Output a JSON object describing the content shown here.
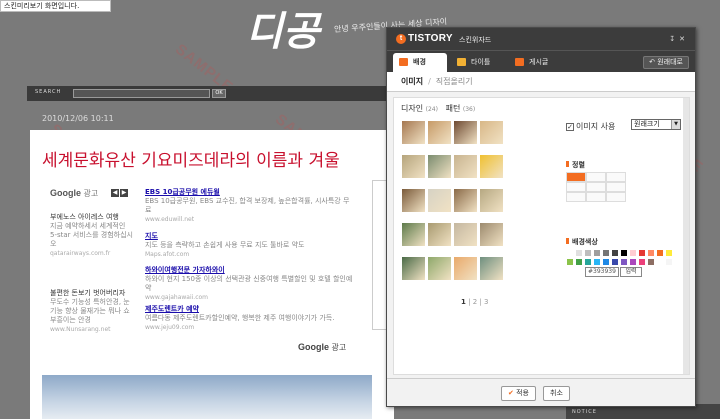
{
  "preview_notice": "스킨미리보기 화면입니다.",
  "watermark": "SAMPLE",
  "blog": {
    "logo": "디공",
    "tagline": "안녕 우주인들이 사는 세상 디자이",
    "search_label": "SEARCH",
    "search_button": "OK",
    "post_date": "2010/12/06 10:11",
    "post_title": "세계문화유산 기요미즈데라의 이름과 겨울",
    "google_label": "Google",
    "ad_word": "광고",
    "left_ads": [
      {
        "title": "부에노스 아이레스 여행",
        "desc": "지금 예약하세서 세계적인 5-star 서비스를 경험하십시오",
        "url": "qatarairways.com.fr"
      },
      {
        "title": "불편한 돈보기 벗어버리자",
        "desc": "무도수 기능성 특허안경, 눈기능 향상 물재가는 뭐나 쇼 부흥이는 안경",
        "url": "www.Nunsarang.net"
      }
    ],
    "right_ads": [
      {
        "title": "EBS 10급공무원 에듀윌",
        "desc": "EBS 10급공무원, EBS 교수진, 합격 보장제, 높은합격률, 시사특강 무료",
        "url": "www.eduwill.net"
      },
      {
        "title": "지도",
        "desc": "지도 등을 측략하고 손쉽게 사용 무료 지도 툴바로 약도",
        "url": "Maps.afot.com"
      },
      {
        "title": "하와이여행전문 가자하와이",
        "desc": "하와이 현지 150종 이상의 선택관광 신중여행 특별할인 및 호텔 할인예약",
        "url": "www.gajahawaii.com"
      },
      {
        "title": "제주도렌트카 예약",
        "desc": "여름다동 제주도렌트카할인예약, 행복한 제주 여행이야기가 가득.",
        "url": "www.jeju09.com"
      }
    ],
    "side_notice": "NOTICE"
  },
  "wizard": {
    "brand": "TISTORY",
    "title": "스킨위자드",
    "window_controls": [
      "↧",
      "✕"
    ],
    "tabs": [
      {
        "label": "배경",
        "active": true,
        "color": "#f36d21"
      },
      {
        "label": "타이틀",
        "active": false,
        "color": "#f2b134"
      },
      {
        "label": "게시글",
        "active": false,
        "color": "#f36d21"
      }
    ],
    "restore_button": "원래대로",
    "subtabs": {
      "active": "이미지",
      "other": "직접올리기"
    },
    "categories": [
      {
        "label": "디자인",
        "count": "(24)"
      },
      {
        "label": "패턴",
        "count": "(36)"
      }
    ],
    "thumbnails": [
      "#a57750",
      "#c69a67",
      "#6e4a32",
      "#d8b787",
      "#b5a47c",
      "#7a8c6f",
      "#c8b490",
      "#f0c030",
      "#7a5a3a",
      "#d6d2c4",
      "#8a6a48",
      "#b6a882",
      "#5d7a4a",
      "#a89a70",
      "#c4b7a0",
      "#9c8a6e",
      "#4a6a46",
      "#8ea86a",
      "#e9a96a",
      "#6e8f7f"
    ],
    "pages": [
      "1",
      "2",
      "3"
    ],
    "current_page": "1",
    "use_image_label": "이미지 사용",
    "use_image_checked": true,
    "size_select": "원래크기",
    "align_label": "정렬",
    "bg_color_label": "배경색상",
    "palette": [
      "#ffffff",
      "#e0e0e0",
      "#bdbdbd",
      "#9e9e9e",
      "#757575",
      "#424242",
      "#000000",
      "#ffcdd2",
      "#e53935",
      "#ff8a65",
      "#f36d21",
      "#ffeb3b",
      "#8bc34a",
      "#43a047",
      "#26a69a",
      "#29b6f6",
      "#1e88e5",
      "#3949ab",
      "#7e57c2",
      "#ab47bc",
      "#ec407a",
      "#8d6e63",
      "#ffffff",
      "#f5f5f5"
    ],
    "hex_value": "#393939",
    "hex_apply": "입력",
    "apply_button": "적용",
    "cancel_button": "취소"
  }
}
